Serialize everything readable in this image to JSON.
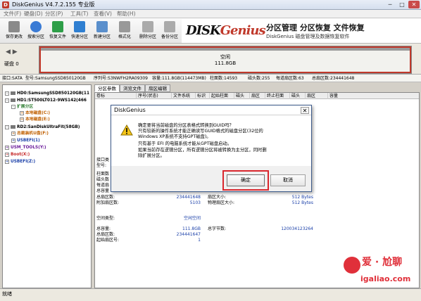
{
  "window": {
    "title": "DiskGenius V4.7.2.155 专业版",
    "min": "─",
    "max": "□",
    "close": "✕"
  },
  "menu": [
    "文件(F)",
    "硬盘(D)",
    "分区(P)",
    "工具(T)",
    "查看(V)",
    "帮助(H)"
  ],
  "toolbar": {
    "items": [
      {
        "label": "保存更改",
        "icon": "save-icon",
        "color": "#8a8a8a"
      },
      {
        "label": "搜索分区",
        "icon": "search-partition-icon",
        "color": "#3a7bd5"
      },
      {
        "label": "恢复文件",
        "icon": "recover-file-icon",
        "color": "#2e9e48"
      },
      {
        "label": "快速分区",
        "icon": "quick-partition-icon",
        "color": "#2f7fd1"
      },
      {
        "label": "新建分区",
        "icon": "new-partition-icon",
        "color": "#5a8fcc"
      },
      {
        "label": "格式化",
        "icon": "format-icon",
        "color": "#999999"
      },
      {
        "label": "删除分区",
        "icon": "delete-partition-icon",
        "color": "#aaaaaa"
      },
      {
        "label": "备份分区",
        "icon": "backup-partition-icon",
        "color": "#aaaaaa"
      }
    ],
    "brand_logo_main": "DISK",
    "brand_logo_k": "Genius",
    "brand_title": "分区管理 分区恢复 文件恢复",
    "brand_subtitle": "DiskGenius 磁盘管理及数据恢复软件"
  },
  "diskbar": {
    "nav": "◀ ▶",
    "disk_label": "硬盘 0",
    "free_label": "空闲",
    "free_size": "111.8GB"
  },
  "infobar": {
    "interface": "接口:SATA",
    "model": "型号:SamsungSSD850120GB",
    "serial": "序列号:S3NWFH2RA09309",
    "capacity": "容量:111.8GB(114473MB)",
    "cylinders": "柱面数:14593",
    "heads": "磁头数:255",
    "sectors": "每道扇区数:63",
    "total_sectors": "总扇区数:234441648"
  },
  "tree": [
    {
      "text": "HD0:SamsungSSD850120GB(11",
      "kind": "disk",
      "color": "#000000"
    },
    {
      "text": "HD1:ST500LT012-9WS142(466",
      "kind": "disk",
      "color": "#000000"
    },
    {
      "text": "扩展分区",
      "kind": "part",
      "color": "#2e7d32"
    },
    {
      "text": "本地磁盘(C:)",
      "kind": "part",
      "color": "#c06000"
    },
    {
      "text": "本地磁盘(E:)",
      "kind": "part",
      "color": "#c06000"
    },
    {
      "text": "RD2:SanDiskUltraFit(58GB)",
      "kind": "disk",
      "color": "#000000"
    },
    {
      "text": "总裁装机U盘(F:)",
      "kind": "part",
      "color": "#c06000"
    },
    {
      "text": "USBEFI(1)",
      "kind": "part",
      "color": "#1a3fa8"
    },
    {
      "text": "USM_TOOLS(Y:)",
      "kind": "part",
      "color": "#6a1b9a"
    },
    {
      "text": "Boot(X:)",
      "kind": "part",
      "color": "#c62828"
    },
    {
      "text": "USBEFI(Z:)",
      "kind": "part",
      "color": "#1a3fa8"
    }
  ],
  "tabs": [
    "分区参数",
    "浏览文件",
    "扇区编辑"
  ],
  "columns": [
    "卷标",
    "序号(状态)",
    "文件系统",
    "标识",
    "起始柱面",
    "磁头",
    "扇区",
    "终止柱面",
    "磁头",
    "扇区",
    "容量"
  ],
  "details": {
    "interface_type": "接口类",
    "model_label": "型号:",
    "cyl_label": "柱面数",
    "head_label": "磁头数",
    "spt_label": "每道扇",
    "cap_label": "总容量",
    "total_sectors_label": "总扇区数:",
    "total_sectors_value": "234441648",
    "additional_sectors_label": "附加扇区数:",
    "additional_sectors_value": "5103",
    "sector_size_label": "扇区大小:",
    "sector_size_value": "512 Bytes",
    "physical_sector_label": "物理扇区大小:",
    "physical_sector_value": "512 Bytes",
    "free_type_label": "空间类型:",
    "free_type_value": "空闲空间",
    "total_cap_label": "总容量:",
    "total_cap_value": "111.8GB",
    "total_bytes_label": "总字节数:",
    "total_bytes_value": "120034123264",
    "sector_count_label": "总扇区数:",
    "sector_count_value": "234441647",
    "start_sector_label": "起始扇区号:",
    "start_sector_value": "1"
  },
  "dialog": {
    "title": "DiskGenius",
    "close": "✕",
    "message_lines": [
      "确定要将当前磁盘的分区表格式转换到GUID吗？",
      "只有较新的操作系统才能正确读写GUID格式的磁盘分区(32位的",
      "Windows XP系统不支持GPT磁盘)。",
      "只有基于 EFI 的电脑系统才能从GPT磁盘启动。",
      "如果当前存在逻辑分区，所有逻辑分区将被转换为主分区，同时删",
      "除扩展分区。"
    ],
    "ok": "确定",
    "cancel": "取消"
  },
  "status": "就绪",
  "watermark": {
    "top": "爱 · 尬聊",
    "bottom": "igaliao.com"
  }
}
